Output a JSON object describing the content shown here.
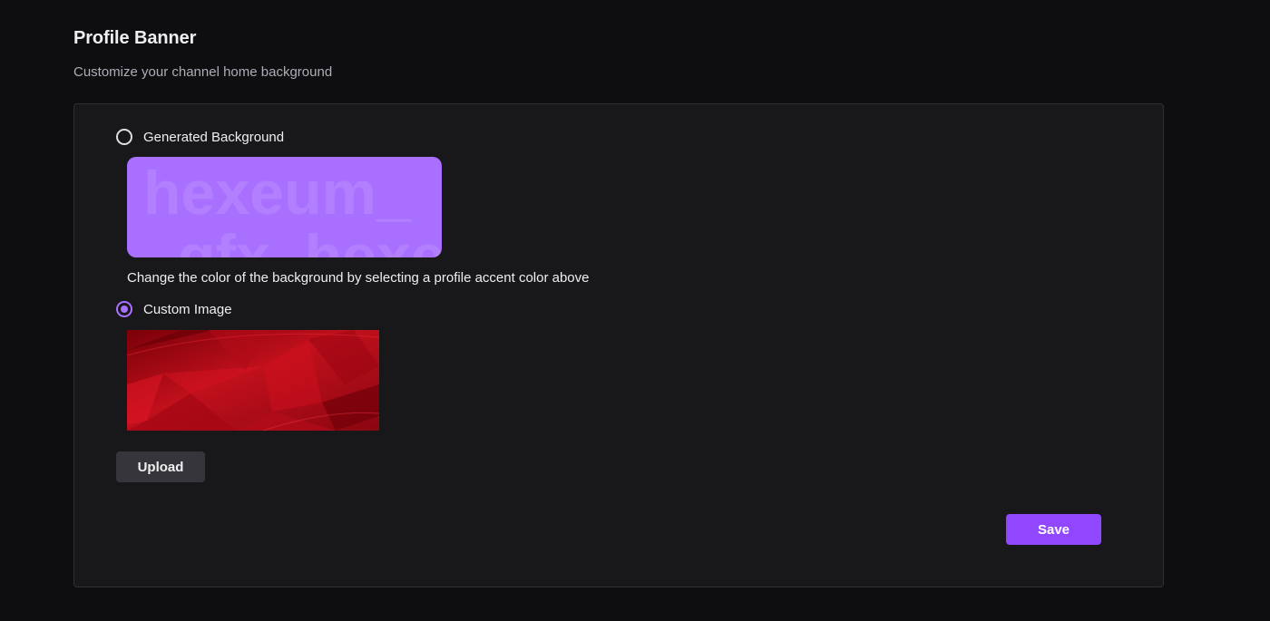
{
  "section": {
    "title": "Profile Banner",
    "subtitle": "Customize your channel home background"
  },
  "options": {
    "generated": {
      "label": "Generated Background",
      "selected": false,
      "preview_text_line1": "hexeum_",
      "preview_text_line2": "_gfx_hexeu",
      "preview_color": "#a970ff"
    },
    "helper_text": "Change the color of the background by selecting a profile accent color above",
    "custom": {
      "label": "Custom Image",
      "selected": true
    }
  },
  "buttons": {
    "upload_label": "Upload",
    "save_label": "Save"
  },
  "colors": {
    "accent": "#9147ff",
    "radio_checked": "#a970ff",
    "banner_red": "#c0101c"
  }
}
